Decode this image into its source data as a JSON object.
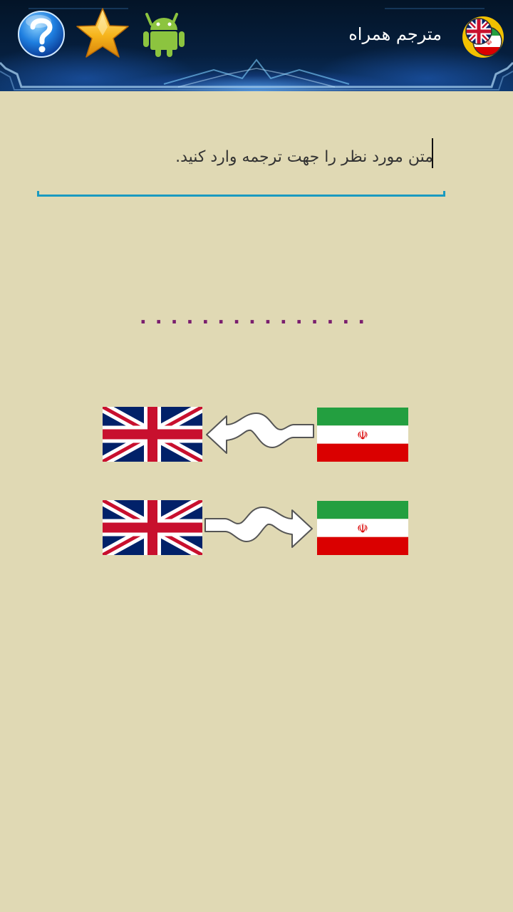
{
  "header": {
    "title": "مترجم همراه",
    "icons": {
      "help": "help-icon",
      "rate": "star-icon",
      "more_apps": "android-icon",
      "logo": "app-logo-icon"
    }
  },
  "input": {
    "placeholder": "متن مورد نظر را جهت ترجمه وارد کنید.",
    "value": ""
  },
  "result": {
    "text": "..............."
  },
  "directions": [
    {
      "from": "fa",
      "to": "en",
      "arrow": "arrow-left-icon"
    },
    {
      "from": "en",
      "to": "fa",
      "arrow": "arrow-right-icon"
    }
  ],
  "colors": {
    "background": "#e0d9b4",
    "accent": "#1a9ac0",
    "result_text": "#7a1e6e",
    "header": "#061f3e"
  }
}
